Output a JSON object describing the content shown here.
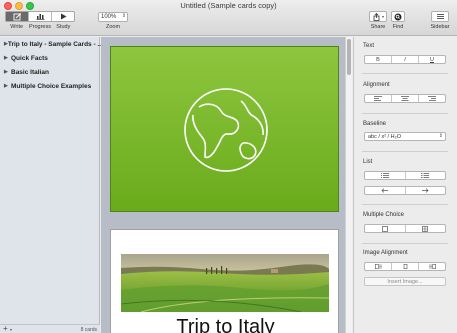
{
  "window": {
    "title": "Untitled (Sample cards copy)"
  },
  "toolbar": {
    "mode_tabs": [
      {
        "label": "Write",
        "icon": "pencil-icon",
        "active": true
      },
      {
        "label": "Progress",
        "icon": "bar-chart-icon",
        "active": false
      },
      {
        "label": "Study",
        "icon": "play-icon",
        "active": false
      }
    ],
    "zoom": {
      "value": "100%",
      "label": "Zoom"
    },
    "share_label": "Share",
    "find_label": "Find",
    "sidebar_label": "Sidebar"
  },
  "sidebar": {
    "decks": [
      {
        "label": "Trip to Italy - Sample Cards - ...",
        "icon": "disclosure-triangle-icon"
      },
      {
        "label": "Quick Facts",
        "icon": "disclosure-triangle-icon"
      },
      {
        "label": "Basic Italian",
        "icon": "disclosure-triangle-icon"
      },
      {
        "label": "Multiple Choice Examples",
        "icon": "disclosure-triangle-icon"
      }
    ],
    "footer": {
      "add": "+",
      "count": "8 cards"
    }
  },
  "canvas": {
    "card1": {
      "image": "globe-icon",
      "background": "#7ab82c"
    },
    "card2": {
      "title": "Trip to Italy",
      "image": "tuscany-landscape-photo"
    }
  },
  "inspector": {
    "text": {
      "title": "Text",
      "buttons": [
        "B",
        "I",
        "U"
      ]
    },
    "alignment": {
      "title": "Alignment",
      "buttons": [
        "align-left-icon",
        "align-center-icon",
        "align-right-icon"
      ]
    },
    "baseline": {
      "title": "Baseline",
      "value": "abc / x² / H₂O"
    },
    "list": {
      "title": "List",
      "buttons": [
        "bulleted-list-icon",
        "numbered-list-icon"
      ],
      "indent": [
        "outdent-icon",
        "indent-icon"
      ]
    },
    "multiple_choice": {
      "title": "Multiple Choice",
      "buttons": [
        "checkbox-icon",
        "checkbox-grid-icon"
      ]
    },
    "image_alignment": {
      "title": "Image Alignment",
      "buttons": [
        "image-left-icon",
        "image-center-icon",
        "image-right-icon"
      ],
      "insert_label": "Insert Image..."
    }
  },
  "colors": {
    "accent": "#6a6a6a",
    "card_green": "#7ab82c",
    "sidebar_bg": "#dfe4ea"
  }
}
